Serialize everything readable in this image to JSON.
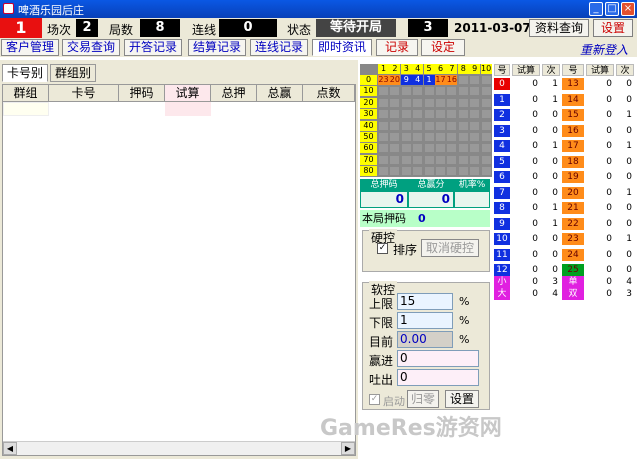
{
  "window": {
    "title": "啤酒乐园后庄"
  },
  "info": {
    "round_no": "1",
    "session_label": "场次",
    "session_value": "2",
    "game_count_label": "局数",
    "game_count_value": "8",
    "streak_label": "连线",
    "streak_value": "0",
    "status_label": "状态",
    "status_value": "等待开局",
    "status_number": "3",
    "date": "2011-03-07",
    "query_button": "资料查询",
    "settings_button": "设置"
  },
  "menu": {
    "tabs": [
      "客户管理",
      "交易查询",
      "开答记录",
      "结算记录",
      "连线记录",
      "即时资讯",
      "记录",
      "设定"
    ],
    "relogin": "重新登入"
  },
  "left": {
    "tabs": [
      "卡号别",
      "群组别"
    ],
    "columns": [
      "群组",
      "卡号",
      "押码",
      "试算",
      "总押",
      "总赢",
      "点数"
    ]
  },
  "grid": {
    "columns": [
      "1",
      "2",
      "3",
      "4",
      "5",
      "6",
      "7",
      "8",
      "9",
      "10"
    ],
    "rows": [
      "0",
      "10",
      "20",
      "30",
      "40",
      "50",
      "60",
      "70",
      "80"
    ],
    "row0": [
      "23",
      "20",
      "9",
      "4",
      "1",
      "17",
      "16",
      "",
      "",
      ""
    ]
  },
  "stats": {
    "total_bet_label": "总押码",
    "total_bet_value": "0",
    "total_score_label": "总赢分",
    "total_score_value": "0",
    "rate_label": "机率%",
    "rate_value": "",
    "round_bet_label": "本局押码",
    "round_bet_value": "0"
  },
  "hard_control": {
    "title": "硬控",
    "sort_label": "排序",
    "cancel_button": "取消硬控"
  },
  "soft_control": {
    "title": "软控",
    "upper_label": "上限",
    "upper_value": "15",
    "lower_label": "下限",
    "lower_value": "1",
    "current_label": "目前",
    "current_value": "0.00",
    "pct": "%",
    "win_label": "赢进",
    "win_value": "0",
    "out_label": "吐出",
    "out_value": "0",
    "start_label": "启动",
    "reset_button": "归零",
    "set_button": "设置"
  },
  "right_table": {
    "headers": [
      "号",
      "试算",
      "次",
      "号",
      "试算",
      "次"
    ],
    "rows": [
      [
        "0",
        "0",
        "1",
        "13",
        "0",
        "0"
      ],
      [
        "1",
        "0",
        "1",
        "14",
        "0",
        "0"
      ],
      [
        "2",
        "0",
        "0",
        "15",
        "0",
        "1"
      ],
      [
        "3",
        "0",
        "0",
        "16",
        "0",
        "0"
      ],
      [
        "4",
        "0",
        "1",
        "17",
        "0",
        "1"
      ],
      [
        "5",
        "0",
        "0",
        "18",
        "0",
        "0"
      ],
      [
        "6",
        "0",
        "0",
        "19",
        "0",
        "0"
      ],
      [
        "7",
        "0",
        "0",
        "20",
        "0",
        "1"
      ],
      [
        "8",
        "0",
        "1",
        "21",
        "0",
        "0"
      ],
      [
        "9",
        "0",
        "1",
        "22",
        "0",
        "0"
      ],
      [
        "10",
        "0",
        "0",
        "23",
        "0",
        "1"
      ],
      [
        "11",
        "0",
        "0",
        "24",
        "0",
        "0"
      ],
      [
        "12",
        "0",
        "0",
        "25",
        "0",
        "0"
      ]
    ],
    "extra": [
      [
        "小",
        "0",
        "3",
        "单",
        "0",
        "4"
      ],
      [
        "大",
        "0",
        "4",
        "双",
        "0",
        "3"
      ]
    ],
    "left_colors": [
      "#e80000",
      "#1030e0",
      "#1030e0",
      "#1030e0",
      "#1030e0",
      "#1030e0",
      "#1030e0",
      "#1030e0",
      "#1030e0",
      "#1030e0",
      "#1030e0",
      "#1030e0",
      "#1030e0"
    ],
    "right_colors": [
      "#ff8c1a",
      "#ff8c1a",
      "#ff8c1a",
      "#ff8c1a",
      "#ff8c1a",
      "#ff8c1a",
      "#ff8c1a",
      "#ff8c1a",
      "#ff8c1a",
      "#ff8c1a",
      "#ff8c1a",
      "#ff8c1a",
      "#00a020"
    ],
    "extra_colors": [
      "#e020e0",
      "#e020e0"
    ]
  },
  "watermark": "GameRes游资网"
}
